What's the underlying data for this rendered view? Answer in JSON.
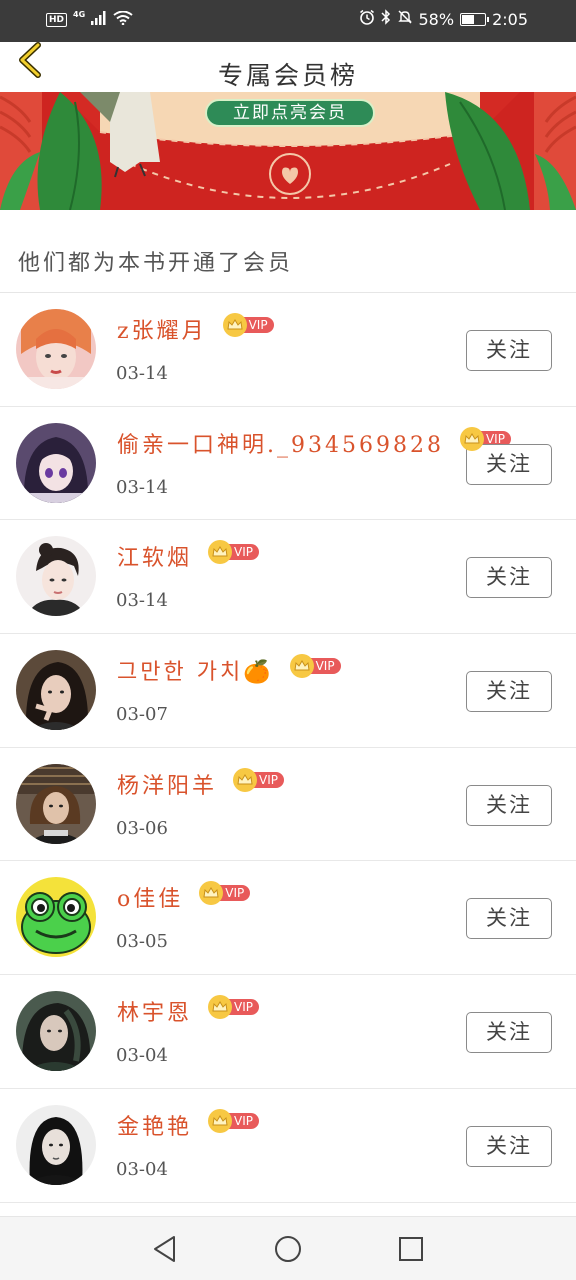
{
  "status_bar": {
    "hd": "HD",
    "network": "4G",
    "battery_text": "58%",
    "battery_level": 0.58,
    "time": "2:05"
  },
  "header": {
    "title": "专属会员榜",
    "back_icon": "chevron-left-icon"
  },
  "banner": {
    "cta_label": "立即点亮会员"
  },
  "section": {
    "heading": "他们都为本书开通了会员"
  },
  "colors": {
    "name": "#d9532c",
    "vip_badge": "#e85a5a",
    "crown": "#f7c843",
    "banner_red": "#d62728",
    "status_bar": "#3b3b3b"
  },
  "members": [
    {
      "name": "z张耀月",
      "vip": "VIP",
      "date": "03-14",
      "follow": "关注"
    },
    {
      "name": "偷亲一口神明._934569828",
      "vip": "VIP",
      "date": "03-14",
      "follow": "关注"
    },
    {
      "name": "江软烟",
      "vip": "VIP",
      "date": "03-14",
      "follow": "关注"
    },
    {
      "name": "그만한 가치🍊",
      "vip": "VIP",
      "date": "03-07",
      "follow": "关注"
    },
    {
      "name": "杨洋阳羊",
      "vip": "VIP",
      "date": "03-06",
      "follow": "关注"
    },
    {
      "name": "o佳佳",
      "vip": "VIP",
      "date": "03-05",
      "follow": "关注"
    },
    {
      "name": "林宇恩",
      "vip": "VIP",
      "date": "03-04",
      "follow": "关注"
    },
    {
      "name": "金艳艳",
      "vip": "VIP",
      "date": "03-04",
      "follow": "关注"
    }
  ],
  "nav": {
    "back_icon": "triangle-back-icon",
    "home_icon": "circle-home-icon",
    "recents_icon": "square-recents-icon"
  }
}
